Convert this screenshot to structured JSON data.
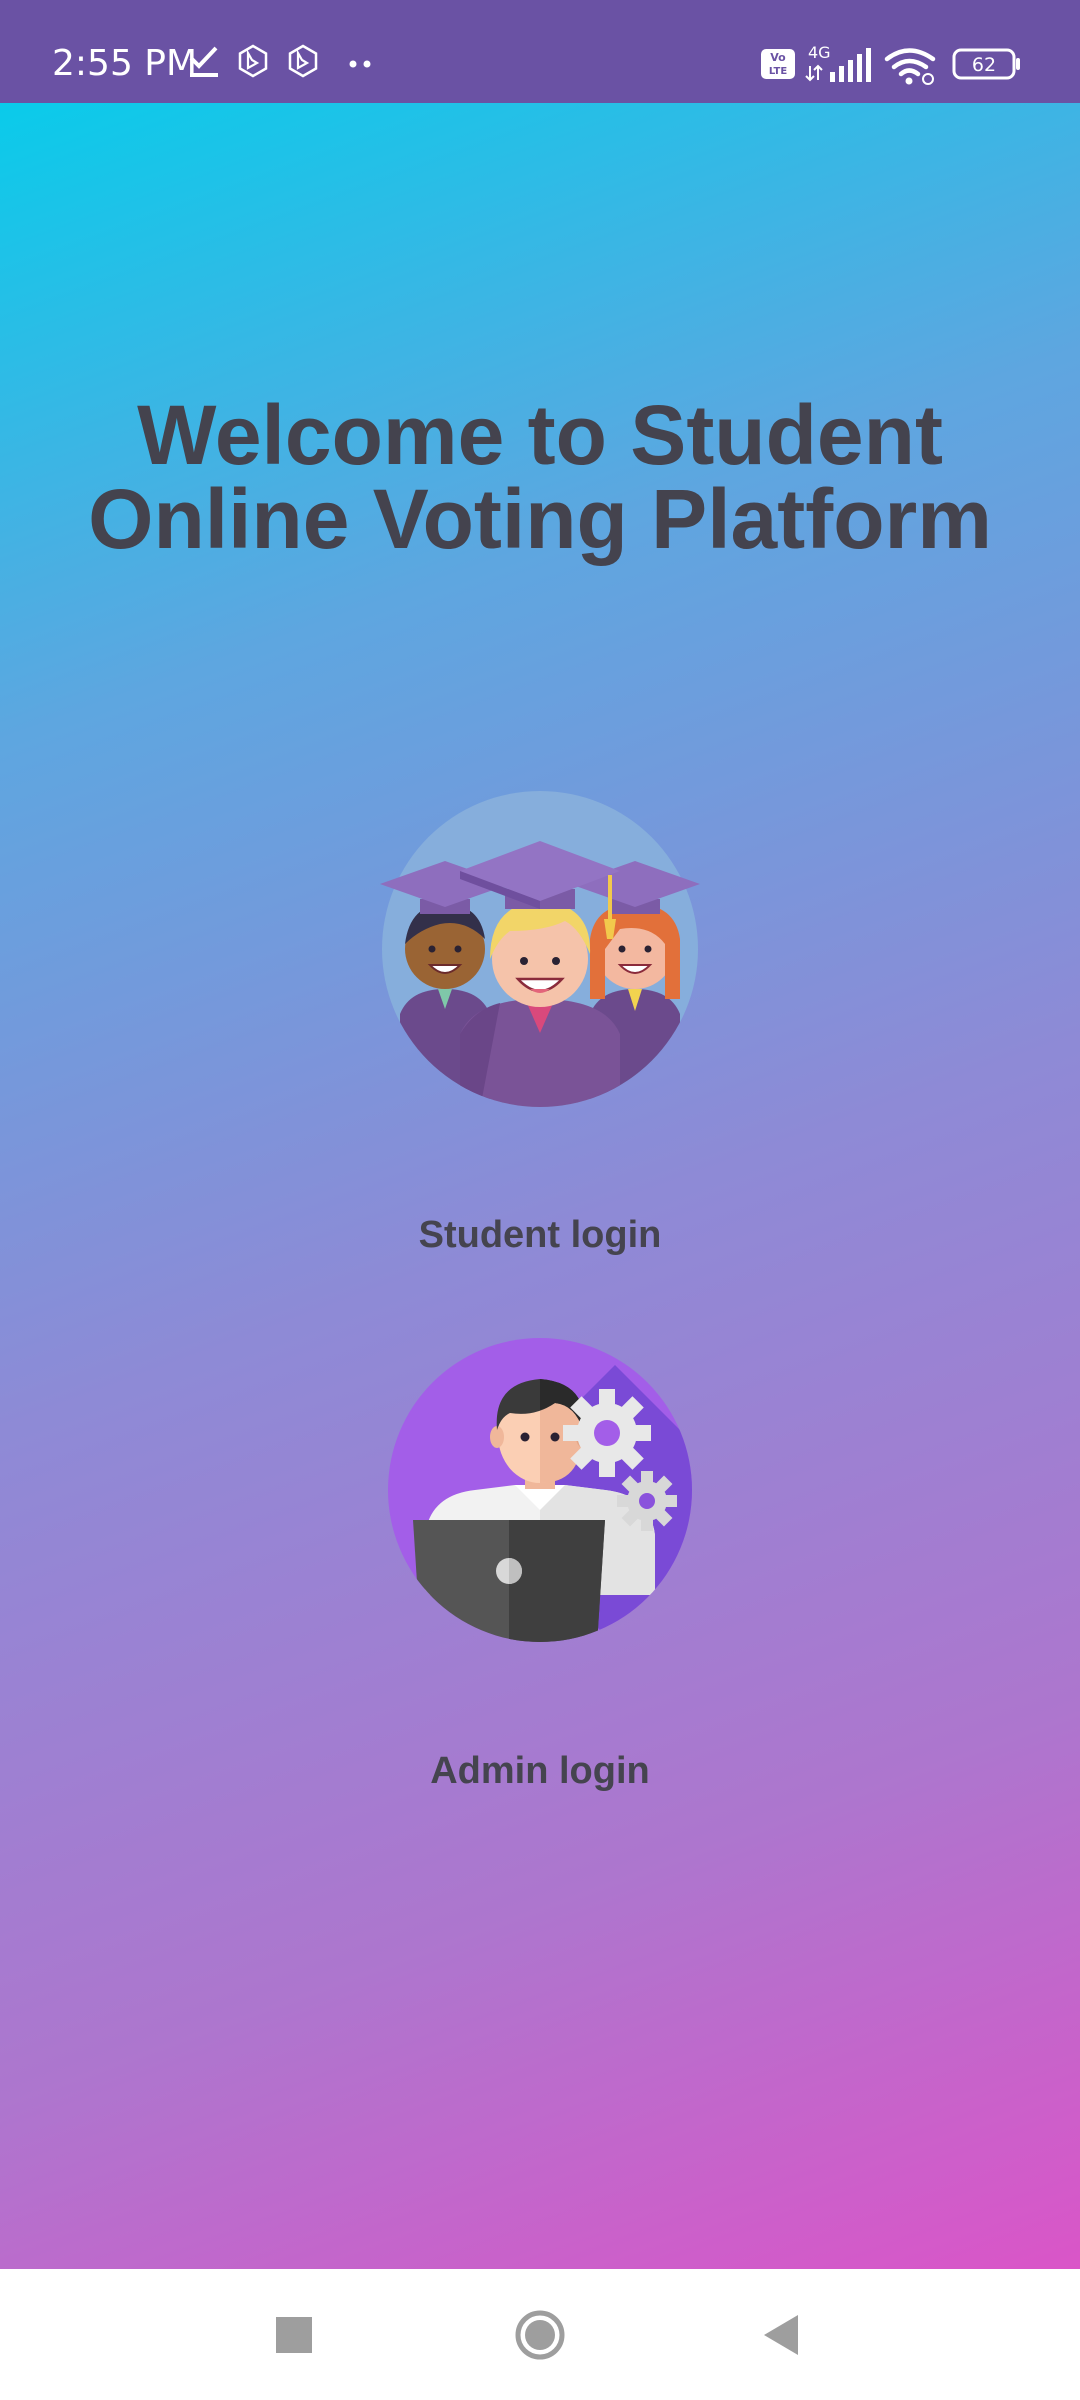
{
  "status_bar": {
    "time": "2:55 PM",
    "battery": "62",
    "network": "4G",
    "volte": "Vo LTE",
    "icons": [
      "check-icon",
      "bing-icon",
      "bing-icon",
      "more-dots-icon",
      "volte-icon",
      "signal-icon",
      "wifi-icon",
      "battery-icon"
    ]
  },
  "main": {
    "title_line1": "Welcome to Student",
    "title_line2": "Online Voting Platform",
    "student_login_label": "Student login",
    "admin_login_label": "Admin login"
  },
  "nav_bar": {
    "icons": [
      "recents-square-icon",
      "home-circle-icon",
      "back-triangle-icon"
    ]
  },
  "colors": {
    "status_bar": "#6a52a4",
    "gradient_start": "#0acbea",
    "gradient_end": "#da55c8",
    "title_text": "#44434e",
    "nav_bar": "#ffffff"
  }
}
